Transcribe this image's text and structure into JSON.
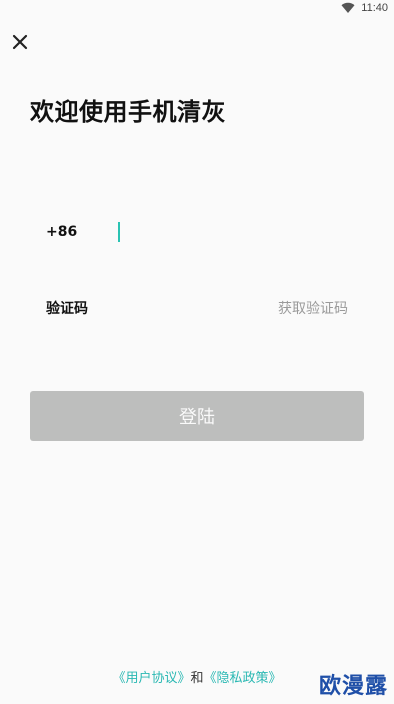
{
  "status_bar": {
    "time": "11:40"
  },
  "header": {
    "title": "欢迎使用手机清灰"
  },
  "phone": {
    "country_code": "+86",
    "value": "",
    "placeholder": ""
  },
  "verify": {
    "label": "验证码",
    "get_code_label": "获取验证码"
  },
  "login": {
    "label": "登陆",
    "disabled_color": "#bdbebd"
  },
  "agreement": {
    "user_agreement": "《用户协议》",
    "connector": "和",
    "privacy_policy": "《隐私政策》"
  },
  "watermark": {
    "text": "欧漫露"
  },
  "colors": {
    "accent": "#2ab8b3",
    "cursor": "#2ac3b3",
    "background": "#fafafa"
  }
}
